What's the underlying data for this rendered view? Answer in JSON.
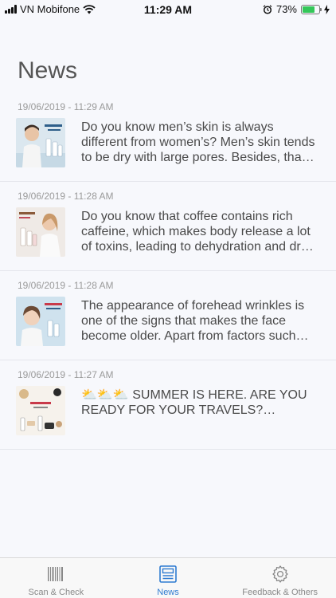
{
  "status_bar": {
    "carrier": "VN Mobifone",
    "time": "11:29 AM",
    "battery_percent": "73%",
    "battery_level": 0.73
  },
  "page": {
    "title": "News"
  },
  "news": [
    {
      "date": "19/06/2019 - 11:29 AM",
      "text": "Do you know men’s skin is always different from women’s? Men’s skin tends to be dry with large pores. Besides, tha…",
      "thumb_accent": "#c9dbe6"
    },
    {
      "date": "19/06/2019 - 11:28 AM",
      "text": "Do you know that coffee contains rich caffeine, which makes body release a lot of toxins, leading to dehydration and dr…",
      "thumb_accent": "#e9e4e0"
    },
    {
      "date": "19/06/2019 - 11:28 AM",
      "text": "The appearance of forehead wrinkles is one of the signs that makes the face become older. Apart from factors such…",
      "thumb_accent": "#bcd6e8"
    },
    {
      "date": "19/06/2019 - 11:27 AM",
      "text": "⛅⛅⛅ SUMMER IS HERE. ARE YOU READY FOR YOUR TRAVELS?…",
      "thumb_accent": "#f2ede6"
    }
  ],
  "tab_bar": {
    "tabs": [
      {
        "label": "Scan & Check",
        "icon": "barcode-icon",
        "active": false
      },
      {
        "label": "News",
        "icon": "newspaper-icon",
        "active": true
      },
      {
        "label": "Feedback & Others",
        "icon": "gear-icon",
        "active": false
      }
    ]
  },
  "colors": {
    "accent": "#2e7bd1",
    "inactive": "#888888",
    "battery": "#34c759"
  }
}
